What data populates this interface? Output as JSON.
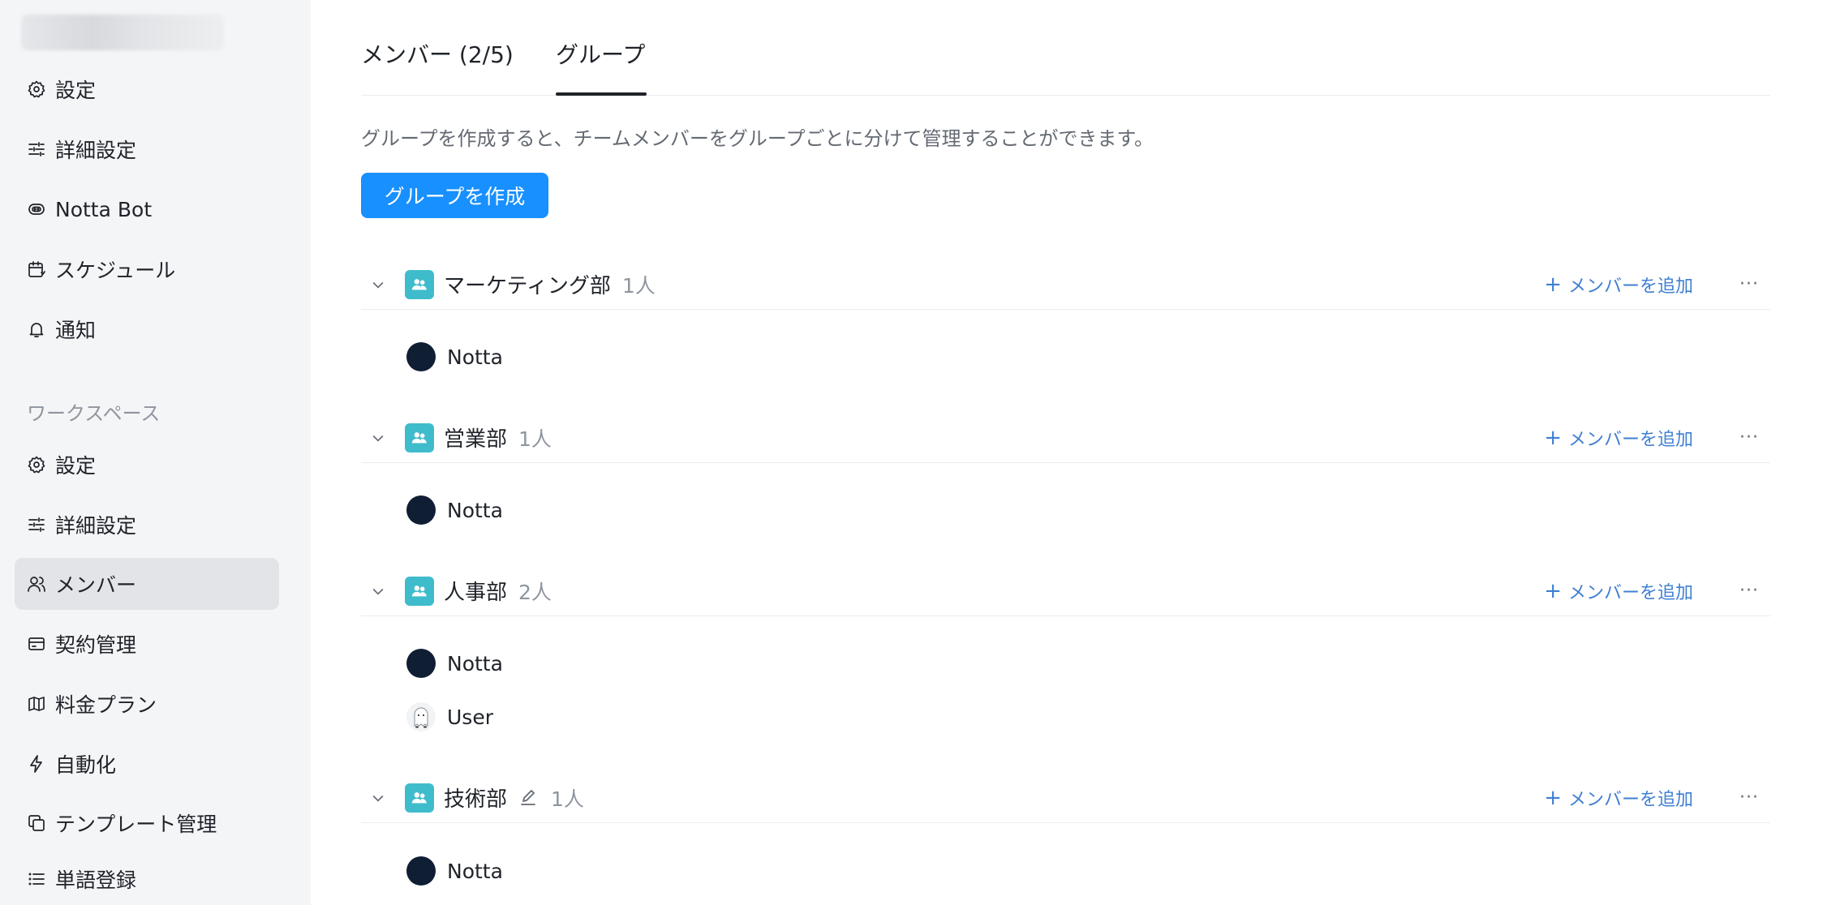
{
  "sidebar": {
    "personal_items": [
      {
        "label": "設定",
        "icon": "gear-icon"
      },
      {
        "label": "詳細設定",
        "icon": "sliders-icon"
      },
      {
        "label": "Notta Bot",
        "icon": "bot-icon"
      },
      {
        "label": "スケジュール",
        "icon": "calendar-icon"
      },
      {
        "label": "通知",
        "icon": "bell-icon"
      }
    ],
    "workspace_section": "ワークスペース",
    "workspace_items": [
      {
        "label": "設定",
        "icon": "gear-icon"
      },
      {
        "label": "詳細設定",
        "icon": "sliders-icon"
      },
      {
        "label": "メンバー",
        "icon": "users-icon",
        "active": true
      },
      {
        "label": "契約管理",
        "icon": "billing-icon"
      },
      {
        "label": "料金プラン",
        "icon": "map-icon"
      },
      {
        "label": "自動化",
        "icon": "bolt-icon"
      },
      {
        "label": "テンプレート管理",
        "icon": "template-icon"
      },
      {
        "label": "単語登録",
        "icon": "list-icon"
      }
    ]
  },
  "tabs": {
    "members": "メンバー (2/5)",
    "groups": "グループ",
    "active": "groups"
  },
  "description": "グループを作成すると、チームメンバーをグループごとに分けて管理することができます。",
  "create_button": "グループを作成",
  "add_member_label": "メンバーを追加",
  "more_label": "···",
  "groups": [
    {
      "name": "マーケティング部",
      "count": "1人",
      "members": [
        {
          "name": "Notta",
          "avatar": "dark"
        }
      ]
    },
    {
      "name": "営業部",
      "count": "1人",
      "members": [
        {
          "name": "Notta",
          "avatar": "dark"
        }
      ]
    },
    {
      "name": "人事部",
      "count": "2人",
      "members": [
        {
          "name": "Notta",
          "avatar": "dark"
        },
        {
          "name": "User",
          "avatar": "ghost"
        }
      ]
    },
    {
      "name": "技術部",
      "count": "1人",
      "editable": true,
      "members": [
        {
          "name": "Notta",
          "avatar": "dark"
        }
      ]
    }
  ],
  "colors": {
    "primary": "#1890ff",
    "group_icon": "#3fbccc",
    "link": "#3f7fd1",
    "avatar_dark": "#0f1e33"
  }
}
